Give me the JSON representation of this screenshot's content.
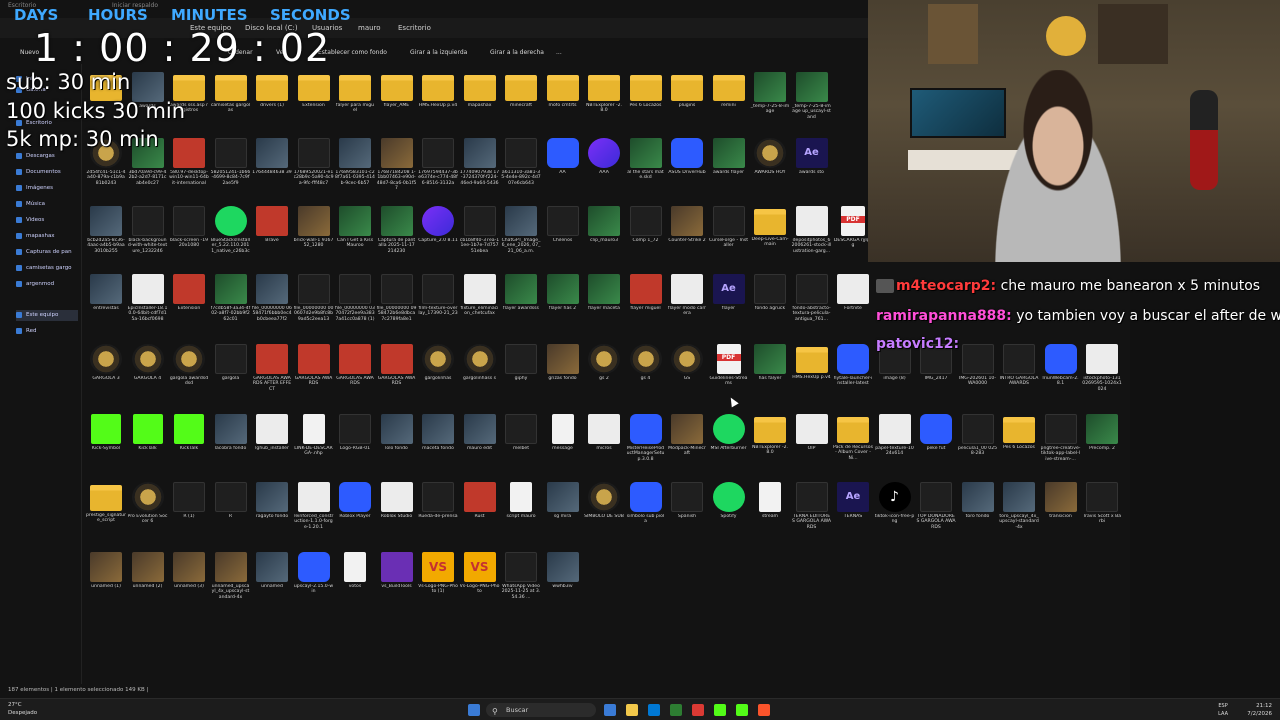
{
  "overlay": {
    "countdown_labels": [
      "DAYS",
      "HOURS",
      "MINUTES",
      "SECONDS"
    ],
    "countdown_time": "1 : 00 :  29 : 02",
    "goals": [
      "sub: 30 min",
      "100 kicks 30 min",
      "5k mp: 30 min"
    ],
    "label_color": "#3fa9ff"
  },
  "explorer": {
    "tabs": [
      "Escritorio",
      "Iniciar respaldo"
    ],
    "breadcrumb": [
      "Este equipo",
      "Disco local (C:)",
      "Usuarios",
      "mauro",
      "Escritorio"
    ],
    "commands": [
      "Nuevo",
      "Ordenar",
      "Ver",
      "Establecer como fondo",
      "Girar a la izquierda",
      "Girar a la derecha",
      "..."
    ],
    "nav_items": [
      {
        "label": "Inicio",
        "sel": false
      },
      {
        "label": "Galería",
        "sel": false
      },
      {
        "label": "Escritorio",
        "sel": false
      },
      {
        "label": "Descargas",
        "sel": false
      },
      {
        "label": "Documentos",
        "sel": false
      },
      {
        "label": "Imágenes",
        "sel": false
      },
      {
        "label": "Música",
        "sel": false
      },
      {
        "label": "Videos",
        "sel": false
      },
      {
        "label": "mapashax",
        "sel": false
      },
      {
        "label": "Capturas de pan",
        "sel": false
      },
      {
        "label": "camisetas gargo",
        "sel": false
      },
      {
        "label": "argenmod",
        "sel": false
      },
      {
        "label": "Este equipo",
        "sel": true
      },
      {
        "label": "Red",
        "sel": false
      }
    ],
    "rows": [
      [
        {
          "label": "",
          "icon": "folder"
        },
        {
          "label": "awards",
          "icon": "thumb"
        },
        {
          "label": "awards sss.asp registros",
          "icon": "folder"
        },
        {
          "label": "camisetas gargolas",
          "icon": "folder"
        },
        {
          "label": "drivers (1)",
          "icon": "folder"
        },
        {
          "label": "Extension",
          "icon": "folder"
        },
        {
          "label": "falyer para miguel",
          "icon": "folder"
        },
        {
          "label": "flayer_AME",
          "icon": "folder"
        },
        {
          "label": "HMS.HexUp p.v4",
          "icon": "folder"
        },
        {
          "label": "mapashax",
          "icon": "folder"
        },
        {
          "label": "minecraft",
          "icon": "folder"
        },
        {
          "label": "mofo cmtrts",
          "icon": "folder"
        },
        {
          "label": "NBTExplorer -2.8.0",
          "icon": "folder"
        },
        {
          "label": "Pes 6 Locazos",
          "icon": "folder"
        },
        {
          "label": "plugins",
          "icon": "folder"
        },
        {
          "label": "remini",
          "icon": "folder"
        },
        {
          "label": "_temp-7-25-8-image",
          "icon": "thumb3"
        },
        {
          "label": "_temp-7-25-8-image up_uscayl-stand",
          "icon": "thumb3"
        }
      ],
      [
        {
          "label": "2d54fc41-51c1-4a40-879a-c1b9a81b0243",
          "icon": "gold"
        },
        {
          "label": "3bd70a9d-c99-42b2-a2d7-8171cab4e0c27",
          "icon": "thumb3"
        },
        {
          "label": "580.97-desktop-win10-win11-64bit-international",
          "icon": "red"
        },
        {
          "label": "582051241-1b66-4699-8c84-7c9f2ae5f9",
          "icon": "dark"
        },
        {
          "label": "17644484638 39",
          "icon": "thumb"
        },
        {
          "label": "17689520021-e1c28b9c-5a90-4c9a-9fc-fff48c7",
          "icon": "dark"
        },
        {
          "label": "17689583101-c28f7a61-0395-414b-9cec-6b57",
          "icon": "thumb"
        },
        {
          "label": "17687184208 1-1bb07463-e90d-48d7-8ca6-0b1f57",
          "icon": "thumb2"
        },
        {
          "label": "17697594437-3be6374e-c774-48f6-8516-3132a",
          "icon": "dark"
        },
        {
          "label": "17740907938 17-3724370f-f224-46ed-9a64-5436",
          "icon": "thumb"
        },
        {
          "label": "a611310-3a81-35-4e4e-892c-4d707e6cb643",
          "icon": "dark"
        },
        {
          "label": "AA",
          "icon": "blue"
        },
        {
          "label": "AAA",
          "icon": "purple"
        },
        {
          "label": "al the stars mate.skd",
          "icon": "thumb3"
        },
        {
          "label": "ASUS DriverHub",
          "icon": "blue"
        },
        {
          "label": "awards flayer",
          "icon": "thumb3"
        },
        {
          "label": "AWARDS HOY",
          "icon": "gold"
        },
        {
          "label": "awards sto",
          "icon": "ae"
        }
      ],
      [
        {
          "label": "bcb2d2a5-8c36-4aac-a4b5-b9aa3010b255",
          "icon": "thumb"
        },
        {
          "label": "black-background-with-white-texture_1232246",
          "icon": "dark"
        },
        {
          "label": "black-screen -1920x1080",
          "icon": "dark"
        },
        {
          "label": "BlueStacksInstaller_5.22.110.2011_native_c26b3c",
          "icon": "green"
        },
        {
          "label": "Brave",
          "icon": "red"
        },
        {
          "label": "brick-wall-1 916752_1280",
          "icon": "thumb2"
        },
        {
          "label": "Can I Get a Kiss Mauroo",
          "icon": "thumb3"
        },
        {
          "label": "Captura de pantalla 2025-11-17 214230",
          "icon": "thumb3"
        },
        {
          "label": "Capture_2.0 8.11",
          "icon": "purple"
        },
        {
          "label": "cb1b8f40-37ea-11ee-1b7e-7d75751ebea",
          "icon": "dark"
        },
        {
          "label": "ChatGPT_Image_6_ene_2026, 07_21_06_a.m.",
          "icon": "thumb"
        },
        {
          "label": "Chilenos",
          "icon": "dark"
        },
        {
          "label": "clip_mauro3",
          "icon": "thumb3"
        },
        {
          "label": "Comp 1_72",
          "icon": "dark"
        },
        {
          "label": "Counter-Strike 2",
          "icon": "thumb2"
        },
        {
          "label": "CurseForge - Installer",
          "icon": "dark"
        },
        {
          "label": "Deep-Live-Cam-main",
          "icon": "folder"
        },
        {
          "label": "depositphotos_62006261-stock-illustration-garg...",
          "icon": "white"
        },
        {
          "label": "DESCARGA rjjlgcg",
          "icon": "pdf"
        }
      ],
      [
        {
          "label": "entrevistas",
          "icon": "thumb"
        },
        {
          "label": "EpicInstaller-18.10.0-64bit-cdf7d15a-16bcf0698",
          "icon": "white"
        },
        {
          "label": "Extension",
          "icon": "red"
        },
        {
          "label": "f7cdb58f-3a34-4f02-a8f7-02bb9f262c01",
          "icon": "thumb3"
        },
        {
          "label": "file_00000000 0658471f6bbb0ec4b0cbeea77f2",
          "icon": "thumb"
        },
        {
          "label": "file_00000000 000607d2e9b8fc8b9ad5c2eea13",
          "icon": "dark"
        },
        {
          "label": "file_00000000 0370472f2ee9a3837a41cc0a878 (1)",
          "icon": "dark"
        },
        {
          "label": "file_00000000 0958472b6e8dbca7c2789fa8e1",
          "icon": "dark"
        },
        {
          "label": "film-texture-overlay_17390-21_23",
          "icon": "dark"
        },
        {
          "label": "fixture_eliminacion_chetcufax",
          "icon": "white"
        },
        {
          "label": "flayer awardsss",
          "icon": "thumb3"
        },
        {
          "label": "flayer has 2",
          "icon": "thumb3"
        },
        {
          "label": "flayer maceta",
          "icon": "thumb3"
        },
        {
          "label": "flayer miguel",
          "icon": "red"
        },
        {
          "label": "flayer modo carrera",
          "icon": "white"
        },
        {
          "label": "flayer",
          "icon": "ae"
        },
        {
          "label": "fondo agruck",
          "icon": "dark"
        },
        {
          "label": "fondo-abstracto-textura-pelicula-antigua_761...",
          "icon": "dark"
        },
        {
          "label": "Fortnite",
          "icon": "white"
        }
      ],
      [
        {
          "label": "GARGOLA 3",
          "icon": "gold"
        },
        {
          "label": "GARGOLA 4",
          "icon": "gold"
        },
        {
          "label": "gargola awardsddsd",
          "icon": "gold"
        },
        {
          "label": "gargola",
          "icon": "dark"
        },
        {
          "label": "GARGOLAS AWARDS AFTER EFFECT",
          "icon": "red"
        },
        {
          "label": "GARGOLAS AWARDS",
          "icon": "red"
        },
        {
          "label": "GARGOLAS AWARDS",
          "icon": "red"
        },
        {
          "label": "GARGOLAS AWARDS",
          "icon": "red"
        },
        {
          "label": "gargolinhas",
          "icon": "gold"
        },
        {
          "label": "gargolinhass s",
          "icon": "gold"
        },
        {
          "label": "giphy",
          "icon": "dark"
        },
        {
          "label": "grizas fondo",
          "icon": "thumb2"
        },
        {
          "label": "gs 2",
          "icon": "gold"
        },
        {
          "label": "gs 4",
          "icon": "gold"
        },
        {
          "label": "GS",
          "icon": "gold"
        },
        {
          "label": "Guidelines-Streams",
          "icon": "pdf"
        },
        {
          "label": "has falyer",
          "icon": "thumb3"
        },
        {
          "label": "HMS.HexUp p.v4",
          "icon": "folder"
        },
        {
          "label": "hytale-launcher-installer-latest",
          "icon": "blue"
        },
        {
          "label": "image (8)",
          "icon": "dark"
        },
        {
          "label": "IMG_2417",
          "icon": "dark"
        },
        {
          "label": "IMG-202601 10-WA0000",
          "icon": "dark"
        },
        {
          "label": "INTRO GARGOLA AWARDS",
          "icon": "dark"
        },
        {
          "label": "IriunWebcam-2.8.1",
          "icon": "blue"
        },
        {
          "label": "istockphoto-1310269595-1024x1024",
          "icon": "white"
        }
      ],
      [
        {
          "label": "Kick-Symbol",
          "icon": "kick"
        },
        {
          "label": "KickTalk",
          "icon": "kick"
        },
        {
          "label": "KickTalk",
          "icon": "kick"
        },
        {
          "label": "lacobra fondo",
          "icon": "thumb"
        },
        {
          "label": "lghub_installer",
          "icon": "white"
        },
        {
          "label": "LINK-DE-DESCARGA-.nhp",
          "icon": "doc"
        },
        {
          "label": "Logo-RGB-01",
          "icon": "dark"
        },
        {
          "label": "lolo fondo",
          "icon": "thumb"
        },
        {
          "label": "maceta fondo",
          "icon": "thumb"
        },
        {
          "label": "mauro edit",
          "icon": "thumb"
        },
        {
          "label": "melbet",
          "icon": "dark"
        },
        {
          "label": "message",
          "icon": "doc"
        },
        {
          "label": "micros",
          "icon": "white"
        },
        {
          "label": "MisterHeiseProductManagerSetup.3.0.8",
          "icon": "blue"
        },
        {
          "label": "Modpack-Minecraft",
          "icon": "thumb2"
        },
        {
          "label": "MSI Afterburner",
          "icon": "green"
        },
        {
          "label": "NBTExplorer -2.8.0",
          "icon": "folder"
        },
        {
          "label": "OIP",
          "icon": "white"
        },
        {
          "label": "Pack de Recursos - Album Cover - Ni...",
          "icon": "folder"
        },
        {
          "label": "papel-texture-1024x614",
          "icon": "white"
        },
        {
          "label": "peke fut",
          "icon": "blue"
        },
        {
          "label": "pelicula1_00 0258-283",
          "icon": "dark"
        },
        {
          "label": "Pes 6 Locazos",
          "icon": "folder"
        },
        {
          "label": "pngtree-creative-tiktok-app-label-live-stream-...",
          "icon": "dark"
        },
        {
          "label": "Precomp. 2",
          "icon": "thumb3"
        }
      ],
      [
        {
          "label": "prestige_signature_script",
          "icon": "folder"
        },
        {
          "label": "Pro Evolution Soccer 6",
          "icon": "gold"
        },
        {
          "label": "R (1)",
          "icon": "dark"
        },
        {
          "label": "R",
          "icon": "dark"
        },
        {
          "label": "ragayto fondo",
          "icon": "thumb"
        },
        {
          "label": "reinforced_construction-1.1.0-forge-1.20.1",
          "icon": "white"
        },
        {
          "label": "Roblox Player",
          "icon": "blue"
        },
        {
          "label": "Roblox Studio",
          "icon": "white"
        },
        {
          "label": "Rueda-de-prensa",
          "icon": "dark"
        },
        {
          "label": "Rust",
          "icon": "red"
        },
        {
          "label": "script mauro",
          "icon": "doc"
        },
        {
          "label": "sg mira",
          "icon": "thumb"
        },
        {
          "label": "SIMBOLO DE SUB",
          "icon": "gold"
        },
        {
          "label": "simbolo sub piola",
          "icon": "blue"
        },
        {
          "label": "Spanish",
          "icon": "dark"
        },
        {
          "label": "Spotify",
          "icon": "green"
        },
        {
          "label": "stream",
          "icon": "doc"
        },
        {
          "label": "TERNA EDITORES GARGOLA AWARDS",
          "icon": "dark"
        },
        {
          "label": "TERNAS",
          "icon": "ae"
        },
        {
          "label": "tiktok-icon-free-png",
          "icon": "tiktok"
        },
        {
          "label": "TOP DONADORES GARGOLA AWARDS",
          "icon": "dark"
        },
        {
          "label": "toro fondo",
          "icon": "thumb"
        },
        {
          "label": "toro_upscayl_4x_upscayl-standard-4x",
          "icon": "thumb"
        },
        {
          "label": "transicion",
          "icon": "thumb2"
        },
        {
          "label": "Travis Scott x Barbi",
          "icon": "dark"
        }
      ],
      [
        {
          "label": "unnamed (1)",
          "icon": "thumb2"
        },
        {
          "label": "unnamed (2)",
          "icon": "thumb2"
        },
        {
          "label": "unnamed (3)",
          "icon": "thumb2"
        },
        {
          "label": "unnamed_upscayl_4x_upscayl-standard-4x",
          "icon": "thumb2"
        },
        {
          "label": "unnamed",
          "icon": "thumb"
        },
        {
          "label": "upscayl-2.15.0-win",
          "icon": "blue"
        },
        {
          "label": "votos",
          "icon": "doc"
        },
        {
          "label": "vs_BuildTools",
          "icon": "vsb"
        },
        {
          "label": "Vs-Logo-PNG-Photo (1)",
          "icon": "vs"
        },
        {
          "label": "Vs-Logo-PNG-Photo",
          "icon": "vs"
        },
        {
          "label": "WhatsApp Video 2025-11-25 at 3.54.36 ...",
          "icon": "dark"
        },
        {
          "label": "wwhb3iv",
          "icon": "thumb"
        }
      ]
    ],
    "status": "187 elementos  |  1 elemento seleccionado  149 KB  |"
  },
  "chat": [
    {
      "user": "m4teocarp2:",
      "text": " che mauro me banearon x 5 minutos",
      "color": "#ff3b3b"
    },
    {
      "user": "ramirapanna888:",
      "text": " yo tambien voy a buscar el after de wes",
      "color": "#ff4fd8"
    },
    {
      "user": "patovic12:",
      "text": "",
      "color": "#c67cff"
    }
  ],
  "taskbar": {
    "weather_temp": "27°C",
    "weather_desc": "Despejado",
    "search_label": "Buscar",
    "lang_top": "ESP",
    "lang_bottom": "LAA",
    "time": "21:12",
    "date": "7/2/2026",
    "app_colors": [
      "#3a7bd5",
      "#f2c84b",
      "#0078d4",
      "#2d7d32",
      "#db3a34",
      "#53fc18",
      "#53fc18",
      "#fb542b"
    ]
  }
}
